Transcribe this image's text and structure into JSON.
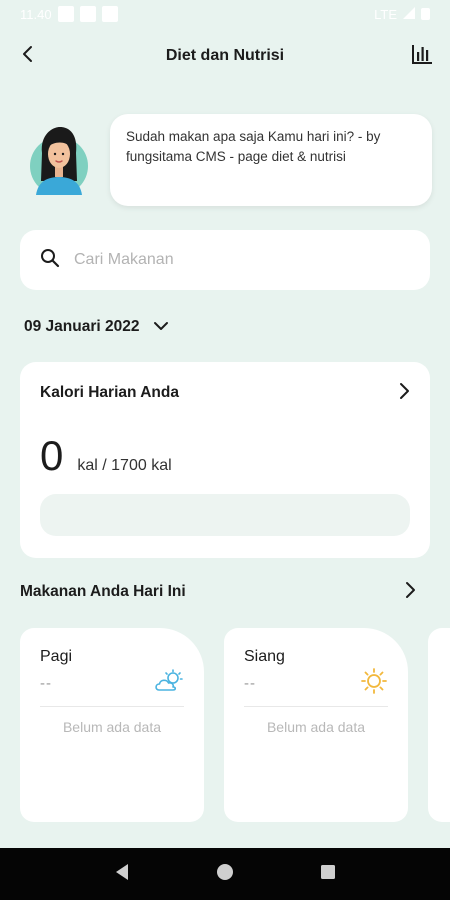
{
  "status_bar": {
    "time": "11.40",
    "network": "LTE"
  },
  "appbar": {
    "title": "Diet dan Nutrisi",
    "back_icon": "back-arrow-icon",
    "chart_icon": "bar-chart-icon"
  },
  "greeting": {
    "message": "Sudah makan apa saja Kamu hari ini? - by fungsitama CMS - page diet & nutrisi"
  },
  "search": {
    "placeholder": "Cari Makanan",
    "value": "",
    "icon": "search-icon"
  },
  "date": {
    "label": "09 Januari 2022",
    "icon": "chevron-down-icon"
  },
  "calorie": {
    "title": "Kalori Harian Anda",
    "current": "0",
    "target_text": "kal / 1700 kal",
    "progress": 0
  },
  "meals": {
    "title": "Makanan Anda Hari Ini",
    "items": [
      {
        "name": "Pagi",
        "kal": "--",
        "icon": "partly-cloudy-icon",
        "empty_text": "Belum ada data"
      },
      {
        "name": "Siang",
        "kal": "--",
        "icon": "sun-icon",
        "empty_text": "Belum ada data"
      }
    ]
  },
  "colors": {
    "background": "#e8f3ef",
    "accent": "#7ccdb5",
    "morning_icon": "#4ab3e0",
    "noon_icon": "#f2b83c"
  },
  "nav": {
    "back_icon": "nav-back-icon",
    "home_icon": "nav-home-icon",
    "recents_icon": "nav-recents-icon"
  }
}
